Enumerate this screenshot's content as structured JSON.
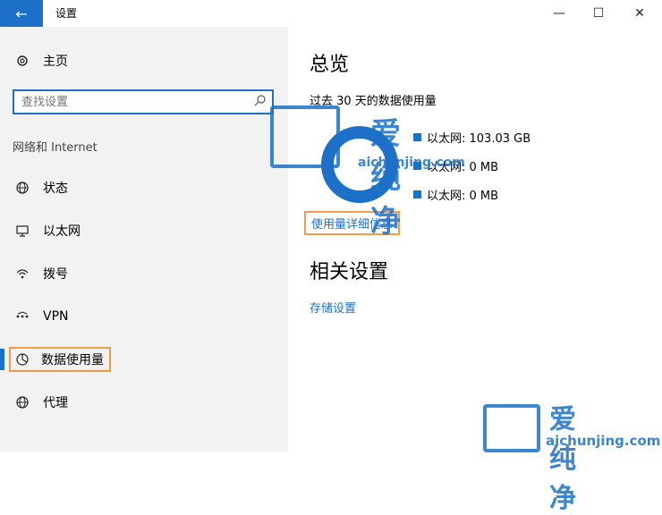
{
  "window": {
    "title": "设置",
    "back_glyph": "←",
    "min_glyph": "—",
    "max_glyph": "☐",
    "close_glyph": "✕"
  },
  "sidebar": {
    "home_label": "主页",
    "search_placeholder": "查找设置",
    "section_title": "网络和 Internet",
    "items": [
      {
        "label": "状态",
        "icon": "globe-status-icon"
      },
      {
        "label": "以太网",
        "icon": "ethernet-icon"
      },
      {
        "label": "拨号",
        "icon": "dialup-icon"
      },
      {
        "label": "VPN",
        "icon": "vpn-icon"
      },
      {
        "label": "数据使用量",
        "icon": "data-usage-icon",
        "active": true
      },
      {
        "label": "代理",
        "icon": "proxy-globe-icon"
      }
    ]
  },
  "main": {
    "overview_title": "总览",
    "overview_subtitle": "过去 30 天的数据使用量",
    "usage_rows": [
      "以太网: 103.03 GB",
      "以太网: 0 MB",
      "以太网: 0 MB"
    ],
    "detail_link": "使用量详细信息",
    "related_title": "相关设置",
    "storage_link": "存储设置"
  },
  "watermark": {
    "text_cn": "爱纯净",
    "text_en": "aichunjing.com"
  },
  "colors": {
    "accent": "#1c70c8",
    "highlight_box": "#f29b4a",
    "sidebar_bg": "#f2f2f2"
  }
}
